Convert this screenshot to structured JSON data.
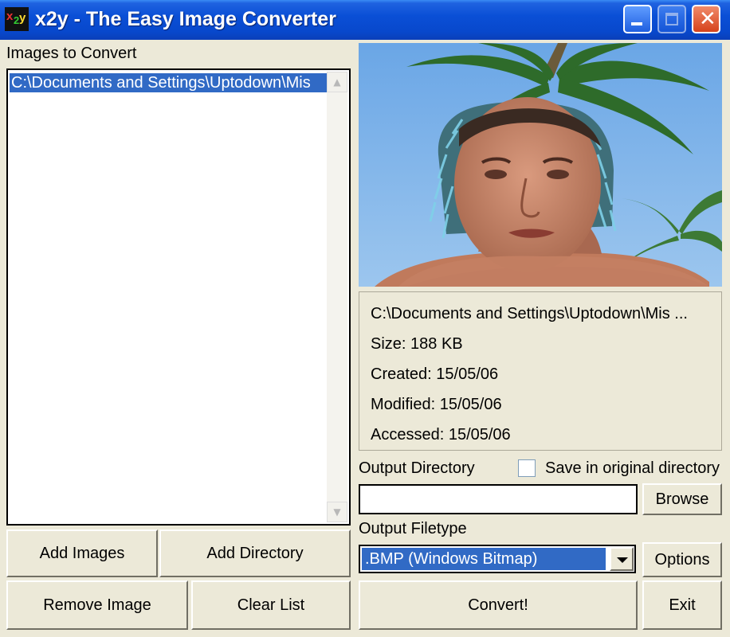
{
  "window": {
    "title": "x2y - The Easy Image Converter",
    "icon": "x2y-app-icon",
    "controls": {
      "minimize": "minimize-icon",
      "maximize": "maximize-icon",
      "close": "close-icon"
    }
  },
  "images_panel": {
    "label": "Images to Convert",
    "items": [
      "C:\\Documents and Settings\\Uptodown\\Mis"
    ]
  },
  "buttons": {
    "add_images": "Add Images",
    "add_directory": "Add Directory",
    "remove_image": "Remove Image",
    "clear_list": "Clear List",
    "browse": "Browse",
    "options": "Options",
    "convert": "Convert!",
    "exit": "Exit"
  },
  "file_info": {
    "path": "C:\\Documents and Settings\\Uptodown\\Mis ...",
    "size": "Size: 188 KB",
    "created": "Created: 15/05/06",
    "modified": "Modified: 15/05/06",
    "accessed": "Accessed: 15/05/06"
  },
  "output": {
    "directory_label": "Output Directory",
    "directory_value": "",
    "save_original_label": "Save in original directory",
    "save_original_checked": false,
    "filetype_label": "Output Filetype",
    "filetype_selected": ".BMP (Windows Bitmap)"
  },
  "colors": {
    "selection": "#316AC5",
    "titlebar": "#0A4FD6",
    "face": "#ECE9D8"
  }
}
